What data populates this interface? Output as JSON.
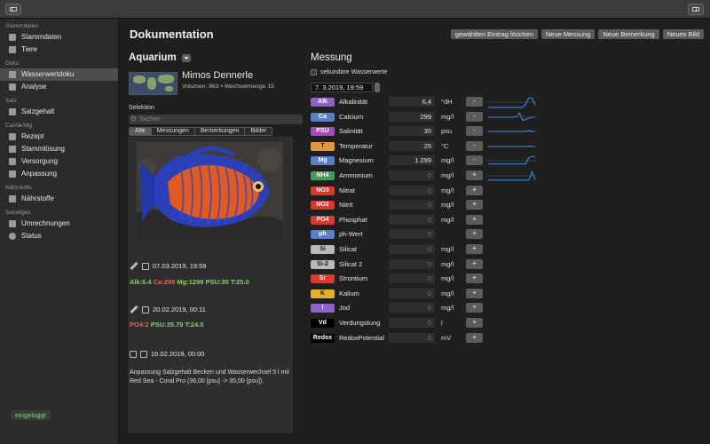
{
  "sidebar": {
    "sections": [
      {
        "label": "Stammdaten",
        "items": [
          {
            "label": "Stammdaten",
            "icon": "database-icon"
          },
          {
            "label": "Tiere",
            "icon": "animals-icon"
          }
        ]
      },
      {
        "label": "Doku",
        "items": [
          {
            "label": "Wasserwertdoku",
            "icon": "document-icon",
            "active": true
          },
          {
            "label": "Analyse",
            "icon": "chart-icon"
          }
        ]
      },
      {
        "label": "Salz",
        "items": [
          {
            "label": "Salzgehalt",
            "icon": "salt-icon"
          }
        ]
      },
      {
        "label": "Ca/Alk/Mg",
        "items": [
          {
            "label": "Rezept",
            "icon": "recipe-icon"
          },
          {
            "label": "Stammlösung",
            "icon": "solution-icon"
          },
          {
            "label": "Versorgung",
            "icon": "supply-icon"
          },
          {
            "label": "Anpassung",
            "icon": "adjust-icon"
          }
        ]
      },
      {
        "label": "Nährstoffe",
        "items": [
          {
            "label": "Nährstoffe",
            "icon": "nutrients-icon"
          }
        ]
      },
      {
        "label": "Sonstiges",
        "items": [
          {
            "label": "Umrechnungen",
            "icon": "conversion-icon"
          },
          {
            "label": "Status",
            "icon": "status-icon"
          }
        ]
      }
    ],
    "login_status": "eingeloggt"
  },
  "header": {
    "title": "Dokumentation",
    "buttons": [
      "gewählten Eintrag löschen",
      "Neue Messung",
      "Neue Bemerkung",
      "Neues Bild"
    ]
  },
  "aquarium": {
    "title": "Aquarium",
    "name": "Mimos Dennerle",
    "meta": "Volumen: 863 • Wechselmenge 15",
    "selection_label": "Selektion",
    "search_placeholder": "Suchen",
    "filters": [
      "Alle",
      "Messungen",
      "Bemerkungen",
      "Bilder"
    ]
  },
  "entries": [
    {
      "datetime": "07.03.2019, 19:59",
      "values": [
        {
          "text": "Alk:6.4",
          "color": "#7ed957"
        },
        {
          "text": "Ca:299",
          "color": "#ff5a4a"
        },
        {
          "text": "Mg:1299",
          "color": "#7ed957"
        },
        {
          "text": "PSU:35",
          "color": "#7ed957"
        },
        {
          "text": "T:25.0",
          "color": "#7ed957"
        }
      ]
    },
    {
      "datetime": "20.02.2019, 00:11",
      "values": [
        {
          "text": "PO4:2",
          "color": "#ff5a4a"
        },
        {
          "text": "PSU:35.79",
          "color": "#7ed957"
        },
        {
          "text": "T:24.0",
          "color": "#7ed957"
        }
      ]
    },
    {
      "datetime": "16.02.2019, 00:00",
      "note": "Anpassung Salzgehalt Becken und Wasserwechsel 5 l mit Red Sea - Coral Pro (36,00 [psu] -> 35,00 [psu])."
    }
  ],
  "messung": {
    "title": "Messung",
    "secondary_label": "sekundäre Wasserwerte",
    "date": "7.  3.2019, 19:59",
    "params": [
      {
        "code": "Alk",
        "name": "Alkalinität",
        "value": "6,4",
        "unit": "°dH",
        "action": "-",
        "color": "#8e63c9",
        "spark": [
          0,
          0,
          0,
          0,
          0,
          0,
          0,
          0,
          0,
          0,
          0,
          0,
          0.3,
          0.9,
          0.9,
          0.2
        ]
      },
      {
        "code": "Ca",
        "name": "Calcium",
        "value": "299",
        "unit": "mg/l",
        "action": "-",
        "color": "#5a7fc7",
        "spark": [
          0.5,
          0.5,
          0.5,
          0.5,
          0.5,
          0.5,
          0.5,
          0.5,
          0.5,
          0.55,
          0.9,
          0.2,
          0.3,
          0.4,
          0.5,
          0.5
        ]
      },
      {
        "code": "PSU",
        "name": "Salinität",
        "value": "35",
        "unit": "psu",
        "action": "-",
        "color": "#a14bb9",
        "spark": [
          0.5,
          0.5,
          0.5,
          0.5,
          0.5,
          0.5,
          0.5,
          0.5,
          0.5,
          0.5,
          0.5,
          0.5,
          0.5,
          0.6,
          0.5,
          0.5
        ]
      },
      {
        "code": "T",
        "name": "Temperatur",
        "value": "25",
        "unit": "°C",
        "action": "-",
        "color": "#e29a3b",
        "spark": [
          0.5,
          0.5,
          0.5,
          0.5,
          0.5,
          0.5,
          0.5,
          0.5,
          0.5,
          0.5,
          0.5,
          0.5,
          0.5,
          0.55,
          0.5,
          0.5
        ]
      },
      {
        "code": "Mg",
        "name": "Magnesium",
        "value": "1.299",
        "unit": "mg/l",
        "action": "-",
        "color": "#5a7fc7",
        "spark": [
          0.2,
          0.2,
          0.2,
          0.2,
          0.2,
          0.2,
          0.2,
          0.2,
          0.2,
          0.2,
          0.2,
          0.2,
          0.2,
          0.8,
          0.9,
          0.9
        ]
      },
      {
        "code": "NH4",
        "name": "Ammonium",
        "value": "0",
        "unit": "mg/l",
        "action": "+",
        "color": "#3fa05a",
        "spark": [
          0.1,
          0.1,
          0.1,
          0.1,
          0.1,
          0.1,
          0.1,
          0.1,
          0.1,
          0.1,
          0.1,
          0.1,
          0.1,
          0.1,
          0.9,
          0.1
        ]
      },
      {
        "code": "NO3",
        "name": "Nitrat",
        "value": "0",
        "unit": "mg/l",
        "action": "+",
        "color": "#d9392f"
      },
      {
        "code": "NO2",
        "name": "Nitrit",
        "value": "0",
        "unit": "mg/l",
        "action": "+",
        "color": "#d9392f"
      },
      {
        "code": "PO4",
        "name": "Phosphat",
        "value": "0",
        "unit": "mg/l",
        "action": "+",
        "color": "#d9392f"
      },
      {
        "code": "ph",
        "name": "ph-Wert",
        "value": "0",
        "unit": "",
        "action": "+",
        "color": "#5a7fc7"
      },
      {
        "code": "Si",
        "name": "Silicat",
        "value": "0",
        "unit": "mg/l",
        "action": "+",
        "color": "#b9b9b9"
      },
      {
        "code": "Si-2",
        "name": "Silicat 2",
        "value": "0",
        "unit": "mg/l",
        "action": "+",
        "color": "#b9b9b9"
      },
      {
        "code": "Sr",
        "name": "Strontium",
        "value": "0",
        "unit": "mg/l",
        "action": "+",
        "color": "#d9392f"
      },
      {
        "code": "K",
        "name": "Kalium",
        "value": "0",
        "unit": "mg/l",
        "action": "+",
        "color": "#e5b02b"
      },
      {
        "code": "I",
        "name": "Jod",
        "value": "0",
        "unit": "mg/l",
        "action": "+",
        "color": "#8e63c9"
      },
      {
        "code": "Vd",
        "name": "Verdungstung",
        "value": "0",
        "unit": "l",
        "action": "+",
        "color": "#000000"
      },
      {
        "code": "Redox",
        "name": "RedoxPotential",
        "value": "0",
        "unit": "mV",
        "action": "+",
        "color": "#000000"
      }
    ]
  },
  "colors": {
    "accent_green": "#7ed957",
    "alert_red": "#ff5a4a",
    "spark_blue": "#3d8fe0"
  }
}
